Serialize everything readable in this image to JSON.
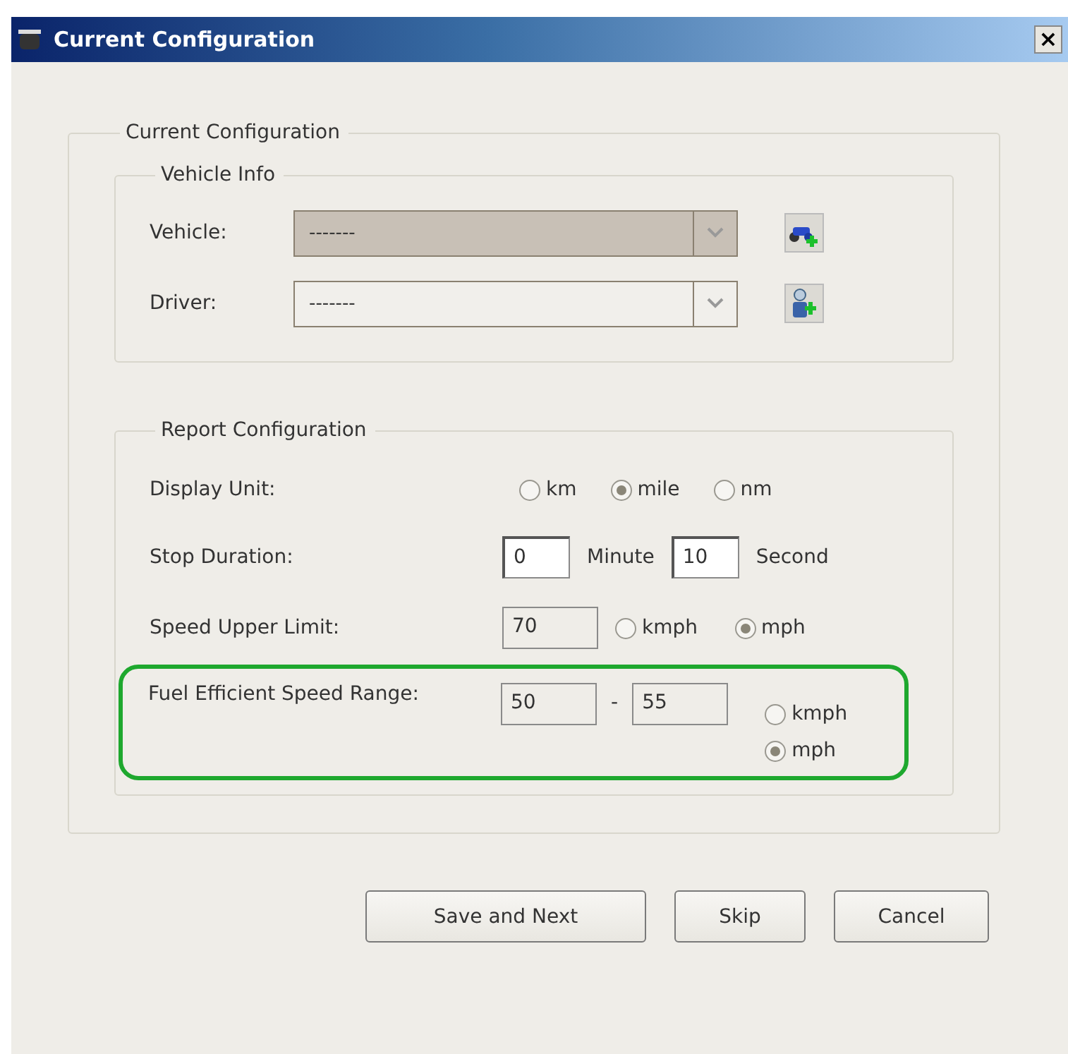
{
  "window": {
    "title": "Current Configuration",
    "close": "×"
  },
  "current_configuration": {
    "legend": "Current Configuration",
    "vehicle_info": {
      "legend": "Vehicle Info",
      "rows": [
        {
          "kind": "vehicle",
          "label": "Vehicle:",
          "value": "-------",
          "disabled": true
        },
        {
          "kind": "driver",
          "label": "Driver:",
          "value": "-------",
          "disabled": false
        }
      ]
    },
    "report_configuration": {
      "legend": "Report Configuration",
      "rows": [
        {
          "kind": "radios",
          "label": "Display Unit:",
          "options": [
            {
              "label": "km",
              "selected": false
            },
            {
              "label": "mile",
              "selected": true
            },
            {
              "label": "nm",
              "selected": false
            }
          ]
        },
        {
          "kind": "duration",
          "label": "Stop Duration:",
          "fields": [
            {
              "value": "0",
              "unit": "Minute"
            },
            {
              "value": "10",
              "unit": "Second"
            }
          ]
        },
        {
          "kind": "limit",
          "label": "Speed Upper Limit:",
          "value": "70",
          "options": [
            {
              "label": "kmph",
              "selected": false
            },
            {
              "label": "mph",
              "selected": true
            }
          ]
        },
        {
          "kind": "range",
          "label": "Fuel Efficient Speed Range:",
          "highlighted": true,
          "from": "50",
          "separator": "-",
          "to": "55",
          "options": [
            {
              "label": "kmph",
              "selected": false
            },
            {
              "label": "mph",
              "selected": true
            }
          ]
        }
      ]
    }
  },
  "buttons": [
    "Save and Next",
    "Skip",
    "Cancel"
  ]
}
